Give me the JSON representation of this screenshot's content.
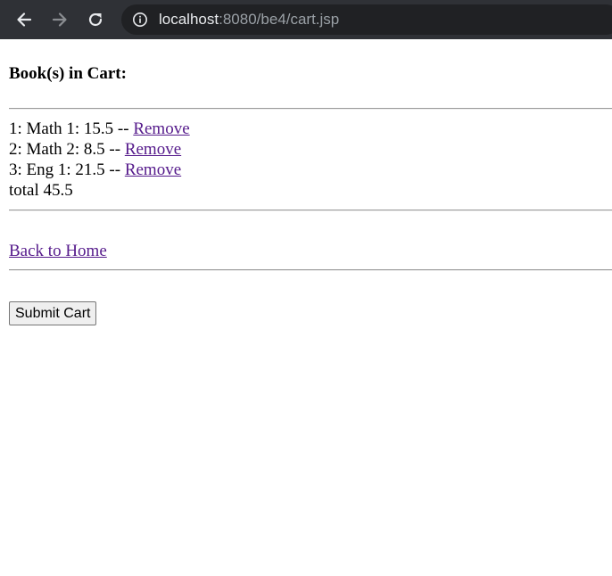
{
  "browser": {
    "url_host": "localhost",
    "url_path": ":8080/be4/cart.jsp"
  },
  "cart": {
    "heading": "Book(s) in Cart:",
    "items": [
      {
        "text": "1: Math 1: 15.5 -- ",
        "remove_label": "Remove"
      },
      {
        "text": "2: Math 2: 8.5 -- ",
        "remove_label": "Remove"
      },
      {
        "text": "3: Eng 1: 21.5 -- ",
        "remove_label": "Remove"
      }
    ],
    "total_text": "total 45.5"
  },
  "nav": {
    "home_link": "Back to Home"
  },
  "form": {
    "submit_label": "Submit Cart"
  },
  "colors": {
    "visited_link": "#551a8b",
    "toolbar_bg": "#2f3136",
    "omnibox_bg": "#202124"
  },
  "icons": {
    "back": "arrow-left-icon",
    "forward": "arrow-right-icon",
    "reload": "reload-icon",
    "site_info": "info-icon"
  }
}
